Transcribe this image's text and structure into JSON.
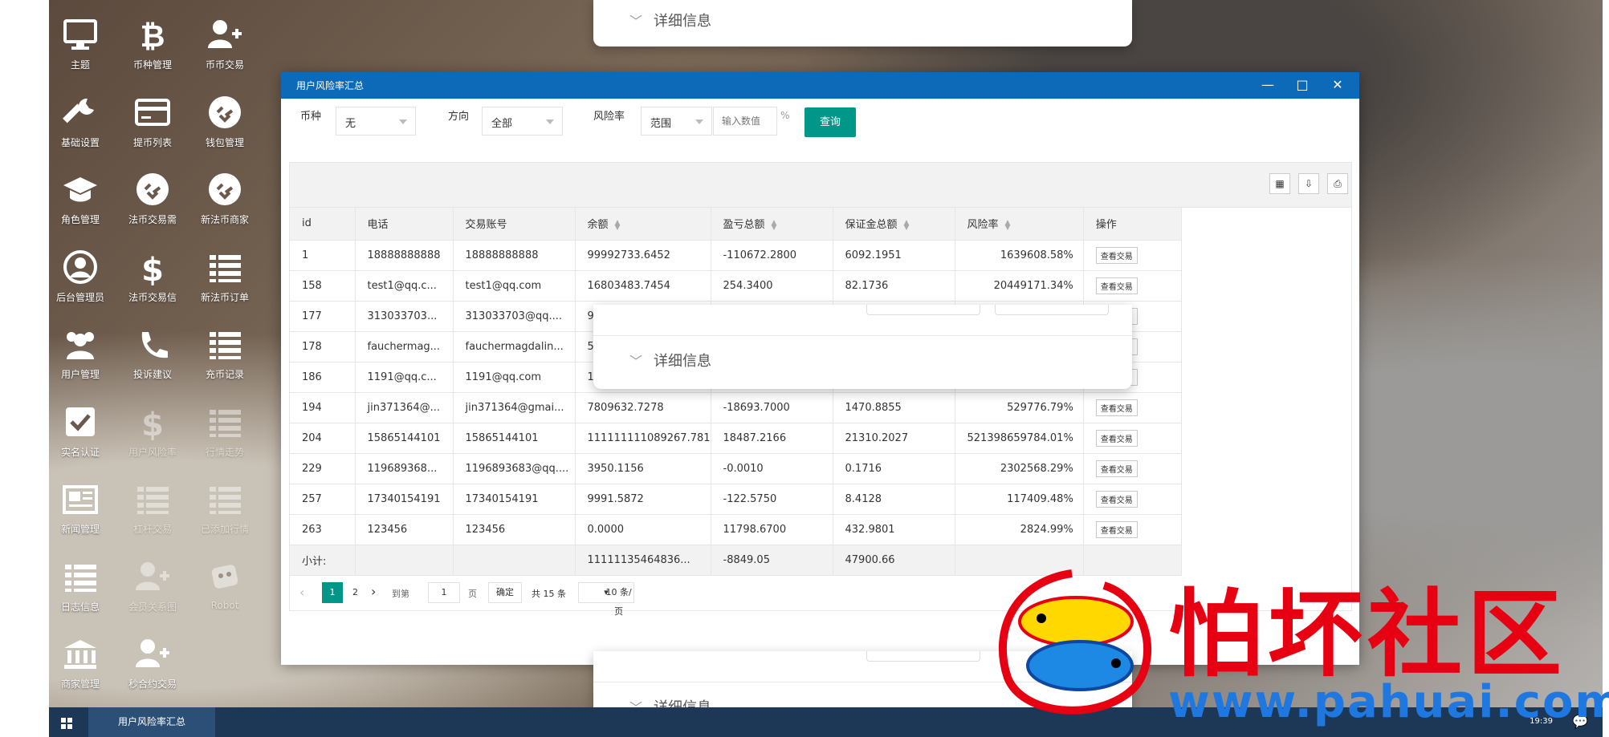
{
  "desktop": {
    "icons": [
      {
        "label": "主题",
        "icon": "monitor-icon"
      },
      {
        "label": "币种管理",
        "icon": "bitcoin-icon"
      },
      {
        "label": "币币交易",
        "icon": "add-user-icon"
      },
      {
        "label": "基础设置",
        "icon": "wrench-icon"
      },
      {
        "label": "提币列表",
        "icon": "card-icon"
      },
      {
        "label": "钱包管理",
        "icon": "link-icon"
      },
      {
        "label": "角色管理",
        "icon": "graduation-cap-icon"
      },
      {
        "label": "法币交易需",
        "icon": "link-icon"
      },
      {
        "label": "新法币商家",
        "icon": "link-icon"
      },
      {
        "label": "后台管理员",
        "icon": "user-circle-icon"
      },
      {
        "label": "法币交易信",
        "icon": "dollar-icon"
      },
      {
        "label": "新法币订单",
        "icon": "list-icon"
      },
      {
        "label": "用户管理",
        "icon": "users-icon"
      },
      {
        "label": "投诉建议",
        "icon": "phone-icon"
      },
      {
        "label": "充币记录",
        "icon": "list-icon"
      },
      {
        "label": "实名认证",
        "icon": "checkbox-icon"
      },
      {
        "label": "用户风险率",
        "icon": "dollar-icon"
      },
      {
        "label": "行情走势",
        "icon": "list-icon"
      },
      {
        "label": "新闻管理",
        "icon": "newspaper-icon"
      },
      {
        "label": "杠杆交易",
        "icon": "list-icon"
      },
      {
        "label": "已添加行情",
        "icon": "list-icon"
      },
      {
        "label": "日志信息",
        "icon": "list-icon"
      },
      {
        "label": "会员关系图",
        "icon": "add-user-icon"
      },
      {
        "label": "Robot",
        "icon": "robot-icon"
      },
      {
        "label": "商家管理",
        "icon": "bank-icon"
      },
      {
        "label": "秒合约交易",
        "icon": "add-user-icon"
      }
    ]
  },
  "details_label": "详细信息",
  "window": {
    "title": "用户风险率汇总",
    "controls": {
      "minimize": "—",
      "maximize": "□",
      "close": "✕"
    }
  },
  "filters": {
    "currency_label": "币种",
    "currency_value": "无",
    "direction_label": "方向",
    "direction_value": "全部",
    "risk_label": "风险率",
    "risk_range_value": "范围",
    "risk_input_placeholder": "输入数值",
    "percent": "%",
    "query_button": "查询"
  },
  "table": {
    "columns": [
      "id",
      "电话",
      "交易账号",
      "余额",
      "盈亏总额",
      "保证金总额",
      "风险率",
      "操作"
    ],
    "action_label": "查看交易",
    "rows": [
      {
        "id": "1",
        "phone": "18888888888",
        "account": "18888888888",
        "balance": "99992733.6452",
        "pnl": "-110672.2800",
        "margin": "6092.1951",
        "risk": "1639608.58%"
      },
      {
        "id": "158",
        "phone": "test1@qq.c...",
        "account": "test1@qq.com",
        "balance": "16803483.7454",
        "pnl": "254.3400",
        "margin": "82.1736",
        "risk": "20449171.34%"
      },
      {
        "id": "177",
        "phone": "313033703...",
        "account": "313033703@qq....",
        "balance": "9",
        "pnl": "",
        "margin": "",
        "risk": ""
      },
      {
        "id": "178",
        "phone": "fauchermag...",
        "account": "fauchermagdalin...",
        "balance": "5",
        "pnl": "",
        "margin": "",
        "risk": ""
      },
      {
        "id": "186",
        "phone": "1191@qq.c...",
        "account": "1191@qq.com",
        "balance": "1",
        "pnl": "",
        "margin": "",
        "risk": ""
      },
      {
        "id": "194",
        "phone": "jin371364@...",
        "account": "jin371364@gmai...",
        "balance": "7809632.7278",
        "pnl": "-18693.7000",
        "margin": "1470.8855",
        "risk": "529776.79%"
      },
      {
        "id": "204",
        "phone": "15865144101",
        "account": "15865144101",
        "balance": "111111111089267.781",
        "pnl": "18487.2166",
        "margin": "21310.2027",
        "risk": "521398659784.01%"
      },
      {
        "id": "229",
        "phone": "119689368...",
        "account": "1196893683@qq....",
        "balance": "3950.1156",
        "pnl": "-0.0010",
        "margin": "0.1716",
        "risk": "2302568.29%"
      },
      {
        "id": "257",
        "phone": "17340154191",
        "account": "17340154191",
        "balance": "9991.5872",
        "pnl": "-122.5750",
        "margin": "8.4128",
        "risk": "117409.48%"
      },
      {
        "id": "263",
        "phone": "123456",
        "account": "123456",
        "balance": "0.0000",
        "pnl": "11798.6700",
        "margin": "432.9801",
        "risk": "2824.99%"
      }
    ],
    "summary": {
      "label": "小计:",
      "balance": "11111135464836...",
      "pnl": "-8849.05",
      "margin": "47900.66"
    }
  },
  "pager": {
    "prev": "‹",
    "page1": "1",
    "page2": "2",
    "next": "›",
    "goto_label": "到第",
    "goto_value": "1",
    "page_unit": "页",
    "confirm": "确定",
    "total": "共 15 条",
    "per_page": "10 条/页"
  },
  "taskbar": {
    "item": "用户风险率汇总",
    "clock": "19:39"
  },
  "watermark": {
    "text": "怕坏社区",
    "url": "www.pahuai.com"
  }
}
